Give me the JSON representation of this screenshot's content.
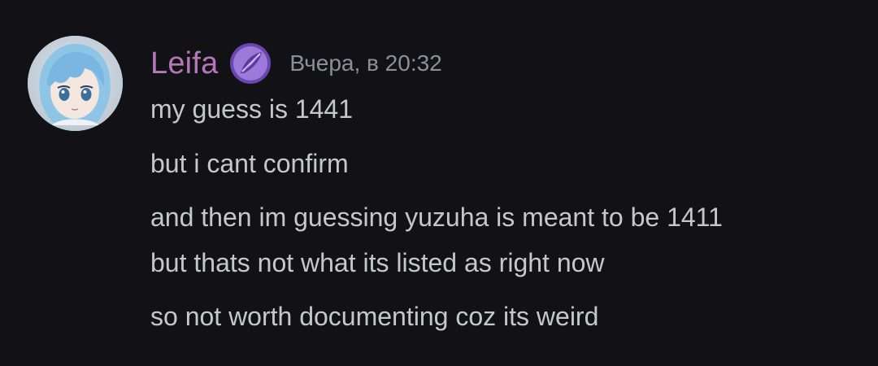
{
  "message": {
    "author": "Leifa",
    "author_color": "#b577b8",
    "timestamp": "Вчера, в 20:32",
    "badge_icon": "purple-feather-badge-icon",
    "avatar_icon": "anime-girl-avatar-icon",
    "lines": [
      "my guess is 1441",
      "but i cant confirm",
      "and then im guessing yuzuha is meant to be 1411",
      "but thats not what its listed as right now",
      "so not worth documenting coz its weird"
    ]
  },
  "colors": {
    "background": "#121216",
    "text": "#c6c7cc",
    "timestamp": "#8d8f98"
  }
}
